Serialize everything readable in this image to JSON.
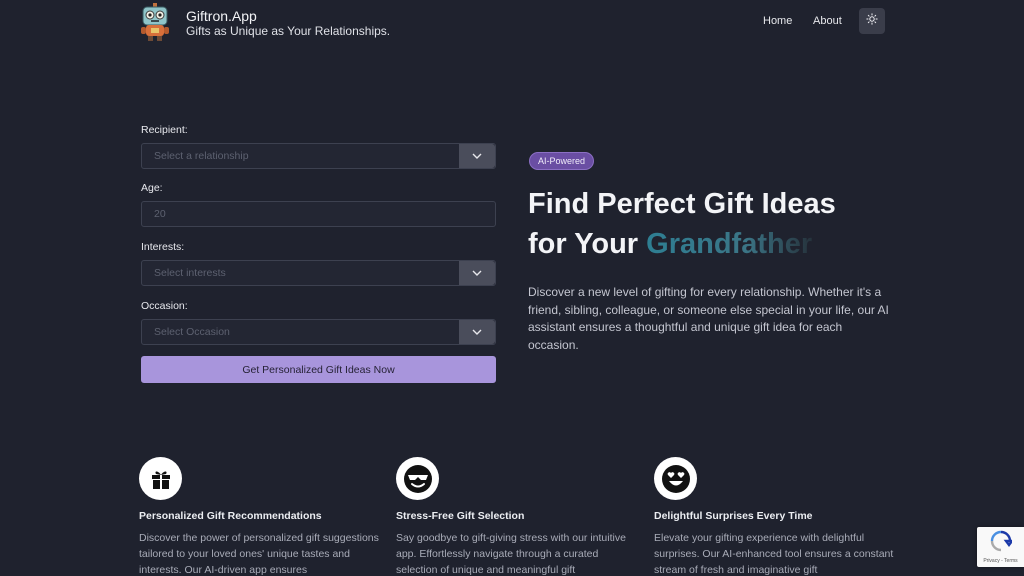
{
  "header": {
    "brand_name": "Giftron.App",
    "tagline": "Gifts as Unique as Your Relationships.",
    "nav": {
      "home": "Home",
      "about": "About"
    },
    "theme_icon": "sun-icon"
  },
  "form": {
    "recipient": {
      "label": "Recipient:",
      "placeholder": "Select a relationship"
    },
    "age": {
      "label": "Age:",
      "placeholder": "20"
    },
    "interests": {
      "label": "Interests:",
      "placeholder": "Select interests"
    },
    "occasion": {
      "label": "Occasion:",
      "placeholder": "Select Occasion"
    },
    "submit_label": "Get Personalized Gift Ideas Now"
  },
  "hero": {
    "badge": "AI-Powered",
    "title_line1": "Find Perfect Gift Ideas",
    "title_line2_prefix": "for Your ",
    "title_accent": "Grandfather",
    "description": "Discover a new level of gifting for every relationship. Whether it's a friend, sibling, colleague, or someone else special in your life, our AI assistant ensures a thoughtful and unique gift idea for each occasion."
  },
  "features": [
    {
      "icon": "gift-icon",
      "title": "Personalized Gift Recommendations",
      "description": "Discover the power of personalized gift suggestions tailored to your loved ones' unique tastes and interests. Our AI-driven app ensures"
    },
    {
      "icon": "cool-face-icon",
      "title": "Stress-Free Gift Selection",
      "description": "Say goodbye to gift-giving stress with our intuitive app. Effortlessly navigate through a curated selection of unique and meaningful gift"
    },
    {
      "icon": "heart-eyes-face-icon",
      "title": "Delightful Surprises Every Time",
      "description": "Elevate your gifting experience with delightful surprises. Our AI-enhanced tool ensures a constant stream of fresh and imaginative gift"
    }
  ],
  "recaptcha": {
    "text": "Privacy - Terms"
  },
  "colors": {
    "background": "#1f222e",
    "button": "#a895dc",
    "badge": "#6a4ea3",
    "accent_gradient": "#2e7f93"
  }
}
